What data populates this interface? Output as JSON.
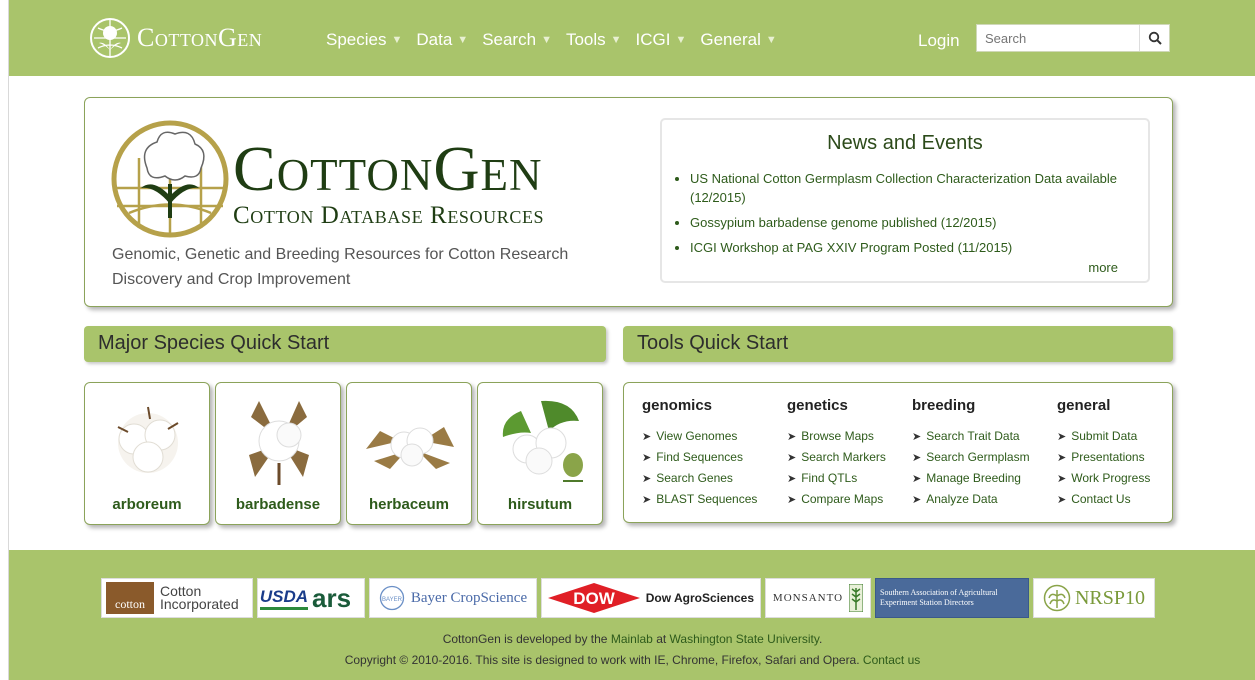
{
  "nav": {
    "brand": "CottonGen",
    "menu": [
      "Species",
      "Data",
      "Search",
      "Tools",
      "ICGI",
      "General"
    ],
    "login": "Login",
    "search_placeholder": "Search"
  },
  "hero": {
    "title": "CottonGen",
    "subtitle": "Cotton Database Resources",
    "tagline": "Genomic, Genetic and Breeding Resources for Cotton Research Discovery and Crop Improvement"
  },
  "news": {
    "heading": "News and Events",
    "items": [
      "US National Cotton Germplasm Collection Characterization Data available (12/2015)",
      "Gossypium barbadense genome published (12/2015)",
      "ICGI Workshop at PAG XXIV Program Posted (11/2015)"
    ],
    "more": "more"
  },
  "species": {
    "heading": "Major Species Quick Start",
    "items": [
      "arboreum",
      "barbadense",
      "herbaceum",
      "hirsutum"
    ]
  },
  "tools": {
    "heading": "Tools Quick Start",
    "columns": [
      {
        "title": "genomics",
        "links": [
          "View Genomes",
          "Find Sequences",
          "Search Genes",
          "BLAST Sequences"
        ]
      },
      {
        "title": "genetics",
        "links": [
          "Browse Maps",
          "Search Markers",
          "Find QTLs",
          "Compare Maps"
        ]
      },
      {
        "title": "breeding",
        "links": [
          "Search Trait Data",
          "Search Germplasm",
          "Manage Breeding",
          "Analyze Data"
        ]
      },
      {
        "title": "general",
        "links": [
          "Submit Data",
          "Presentations",
          "Work Progress",
          "Contact Us"
        ]
      }
    ]
  },
  "footer": {
    "sponsors": {
      "cotton_inc": "Cotton Incorporated",
      "cotton_inc_line1": "Cotton",
      "cotton_inc_line2": "Incorporated",
      "usda": "USDA",
      "bayer": "Bayer CropScience",
      "dow": "DOW",
      "dow_agro": "Dow AgroSciences",
      "monsanto": "MONSANTO",
      "saaesd": "Southern Association of Agricultural Experiment Station Directors",
      "nrsp10": "NRSP10"
    },
    "line1_prefix": "CottonGen is developed by the ",
    "line1_link1": "Mainlab",
    "line1_mid": " at ",
    "line1_link2": "Washington State University",
    "line1_suffix": ".",
    "line2_prefix": "Copyright © 2010-2016. This site is designed to work with IE, Chrome, Firefox, Safari and Opera. ",
    "line2_link": "Contact us"
  },
  "colors": {
    "nav_green": "#a9c46b",
    "dark_green": "#1f3d13",
    "link_green": "#2e5b1b"
  }
}
